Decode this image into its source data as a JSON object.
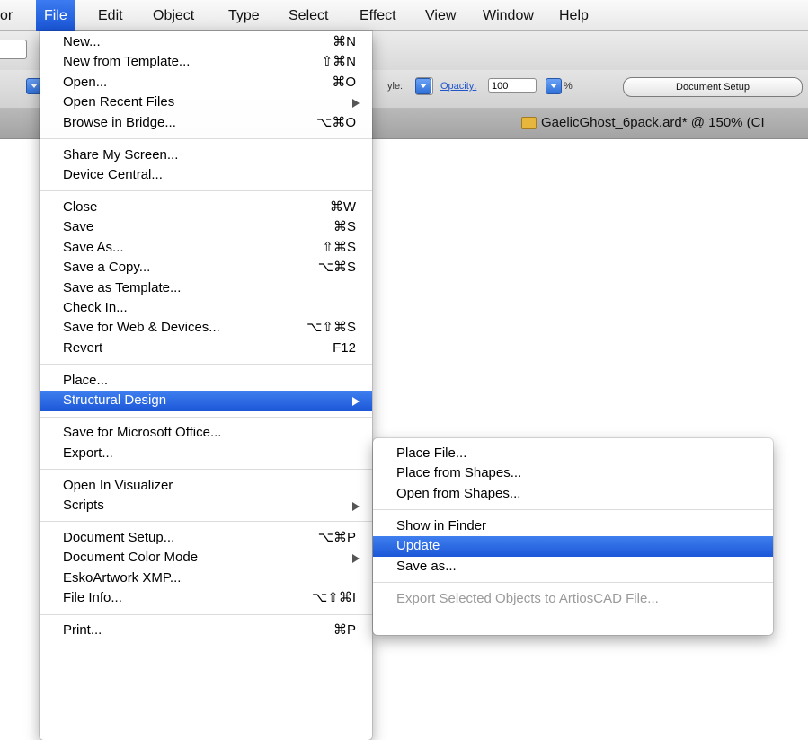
{
  "menubar": {
    "items": [
      "or",
      "File",
      "Edit",
      "Object",
      "Type",
      "Select",
      "Effect",
      "View",
      "Window",
      "Help"
    ]
  },
  "toolbar": {
    "style_label": "yle:",
    "opacity_label": "Opacity:",
    "opacity_value": "100",
    "percent": "%",
    "doc_setup_button": "Document Setup"
  },
  "document_tab": {
    "title": "GaelicGhost_6pack.ard* @ 150% (CI"
  },
  "file_menu": {
    "items": [
      {
        "label": "New...",
        "shortcut": "⌘N"
      },
      {
        "label": "New from Template...",
        "shortcut": "⇧⌘N"
      },
      {
        "label": "Open...",
        "shortcut": "⌘O"
      },
      {
        "label": "Open Recent Files",
        "submenu": true
      },
      {
        "label": "Browse in Bridge...",
        "shortcut": "⌥⌘O"
      },
      {
        "separator": true
      },
      {
        "label": "Share My Screen..."
      },
      {
        "label": "Device Central..."
      },
      {
        "separator": true
      },
      {
        "label": "Close",
        "shortcut": "⌘W"
      },
      {
        "label": "Save",
        "shortcut": "⌘S"
      },
      {
        "label": "Save As...",
        "shortcut": "⇧⌘S"
      },
      {
        "label": "Save a Copy...",
        "shortcut": "⌥⌘S"
      },
      {
        "label": "Save as Template..."
      },
      {
        "label": "Check In..."
      },
      {
        "label": "Save for Web & Devices...",
        "shortcut": "⌥⇧⌘S"
      },
      {
        "label": "Revert",
        "shortcut": "F12"
      },
      {
        "separator": true
      },
      {
        "label": "Place..."
      },
      {
        "label": "Structural Design",
        "submenu": true,
        "highlighted": true
      },
      {
        "separator": true
      },
      {
        "label": "Save for Microsoft Office..."
      },
      {
        "label": "Export..."
      },
      {
        "separator": true
      },
      {
        "label": "Open In Visualizer"
      },
      {
        "label": "Scripts",
        "submenu": true
      },
      {
        "separator": true
      },
      {
        "label": "Document Setup...",
        "shortcut": "⌥⌘P"
      },
      {
        "label": "Document Color Mode",
        "submenu": true
      },
      {
        "label": "EskoArtwork XMP..."
      },
      {
        "label": "File Info...",
        "shortcut": "⌥⇧⌘I"
      },
      {
        "separator": true
      },
      {
        "label": "Print...",
        "shortcut": "⌘P"
      }
    ]
  },
  "structural_design_submenu": {
    "items": [
      {
        "label": "Place File..."
      },
      {
        "label": "Place from Shapes..."
      },
      {
        "label": "Open from Shapes..."
      },
      {
        "separator": true
      },
      {
        "label": "Show in Finder"
      },
      {
        "label": "Update",
        "highlighted": true
      },
      {
        "label": "Save as..."
      },
      {
        "separator": true
      },
      {
        "label": "Export Selected Objects to ArtiosCAD File...",
        "disabled": true
      }
    ]
  },
  "colors": {
    "highlight": "#2a66e2",
    "disabled_text": "#9a9a9a"
  }
}
